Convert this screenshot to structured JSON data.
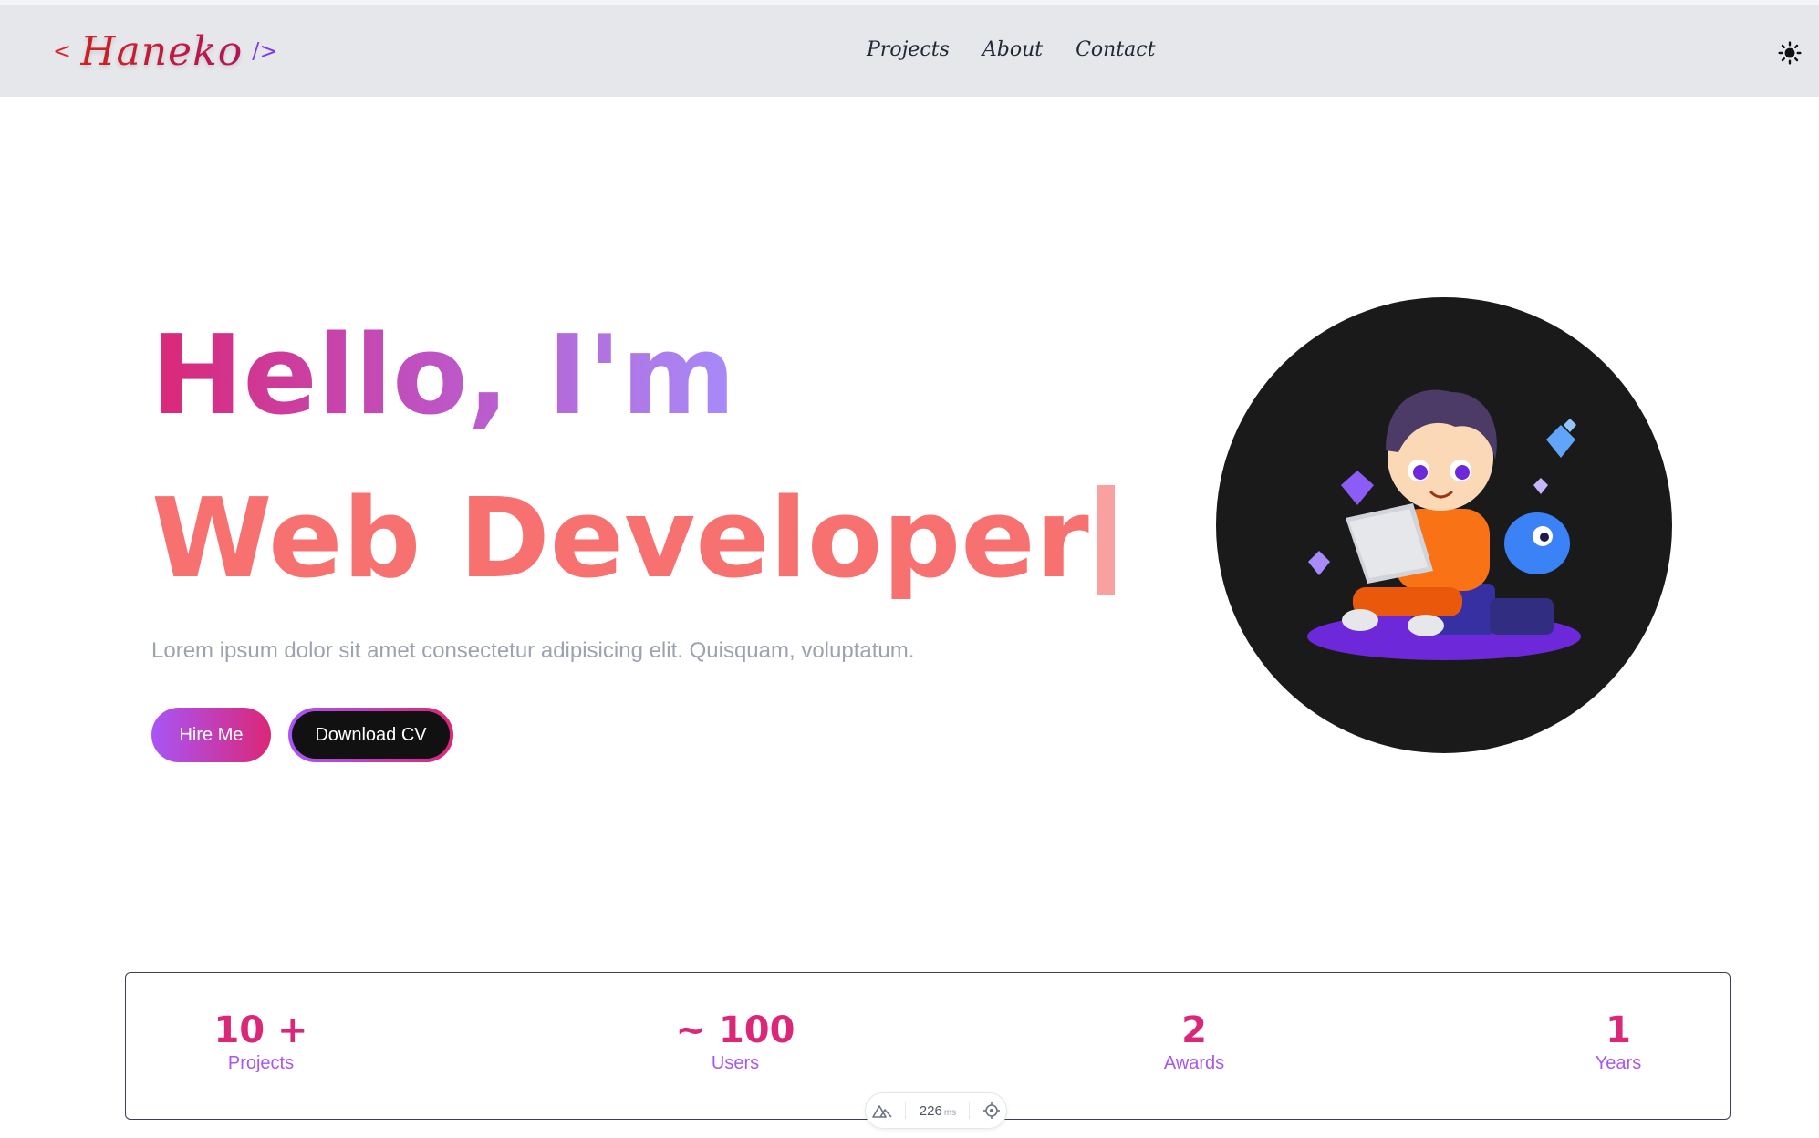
{
  "colors": {
    "accent_pink": "#db2777",
    "accent_purple": "#a855f7",
    "accent_coral": "#f87171",
    "navbar_bg": "#e5e7eb",
    "avatar_bg": "#1a1a1a"
  },
  "navbar": {
    "logo": {
      "open_tag": "<",
      "name": "Haneko",
      "close_tag": "/>"
    },
    "links": [
      "Projects",
      "About",
      "Contact"
    ],
    "theme_icon": "sun-icon"
  },
  "hero": {
    "greeting": "Hello, I'm",
    "role": "Web Developer",
    "description": "Lorem ipsum dolor sit amet consectetur adipisicing elit. Quisquam, voluptatum.",
    "hire_button": "Hire Me",
    "cv_button": "Download CV"
  },
  "stats": [
    {
      "value": "10 +",
      "label": "Projects"
    },
    {
      "value": "~ 100",
      "label": "Users"
    },
    {
      "value": "2",
      "label": "Awards"
    },
    {
      "value": "1",
      "label": "Years"
    }
  ],
  "devtools": {
    "time": "226",
    "unit": "ms"
  }
}
